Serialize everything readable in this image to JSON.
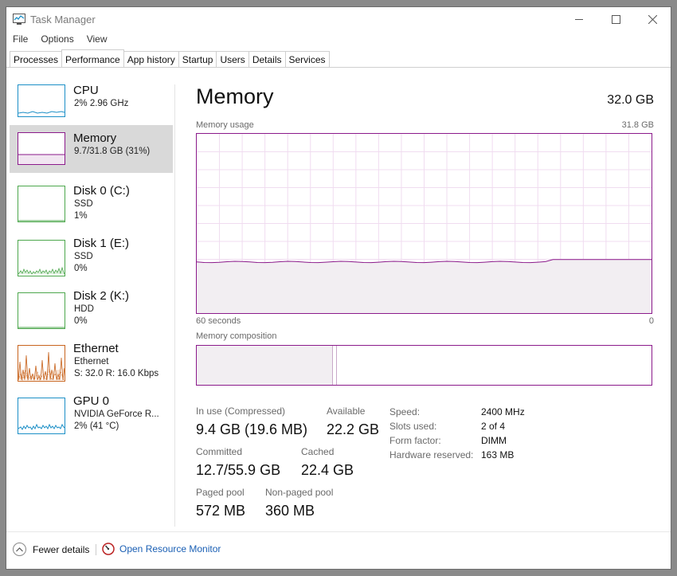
{
  "window": {
    "title": "Task Manager"
  },
  "menu": [
    "File",
    "Options",
    "View"
  ],
  "tabs": [
    "Processes",
    "Performance",
    "App history",
    "Startup",
    "Users",
    "Details",
    "Services"
  ],
  "active_tab": "Performance",
  "sidebar": {
    "items": [
      {
        "title": "CPU",
        "lines": [
          "2% 2.96 GHz"
        ],
        "color": "#1c8fc7"
      },
      {
        "title": "Memory",
        "lines": [
          "9.7/31.8 GB (31%)"
        ],
        "color": "#8b1a8b"
      },
      {
        "title": "Disk 0 (C:)",
        "lines": [
          "SSD",
          "1%"
        ],
        "color": "#4da74d"
      },
      {
        "title": "Disk 1 (E:)",
        "lines": [
          "SSD",
          "0%"
        ],
        "color": "#4da74d"
      },
      {
        "title": "Disk 2 (K:)",
        "lines": [
          "HDD",
          "0%"
        ],
        "color": "#4da74d"
      },
      {
        "title": "Ethernet",
        "lines": [
          "Ethernet",
          "S: 32.0  R: 16.0 Kbps"
        ],
        "color": "#c8641e"
      },
      {
        "title": "GPU 0",
        "lines": [
          "NVIDIA GeForce R...",
          "2% (41 °C)"
        ],
        "color": "#1c8fc7"
      }
    ]
  },
  "main": {
    "title": "Memory",
    "total": "32.0 GB",
    "usage_label": "Memory usage",
    "usage_max": "31.8 GB",
    "x_left": "60 seconds",
    "x_right": "0",
    "composition_label": "Memory composition",
    "accent": "#8b1a8b",
    "usage_fraction": 0.31,
    "composition_in_use_fraction": 0.3
  },
  "stats": {
    "in_use_label": "In use (Compressed)",
    "in_use_value": "9.4 GB (19.6 MB)",
    "available_label": "Available",
    "available_value": "22.2 GB",
    "committed_label": "Committed",
    "committed_value": "12.7/55.9 GB",
    "cached_label": "Cached",
    "cached_value": "22.4 GB",
    "paged_label": "Paged pool",
    "paged_value": "572 MB",
    "nonpaged_label": "Non-paged pool",
    "nonpaged_value": "360 MB"
  },
  "details": {
    "speed_label": "Speed:",
    "speed_value": "2400 MHz",
    "slots_label": "Slots used:",
    "slots_value": "2 of 4",
    "form_label": "Form factor:",
    "form_value": "DIMM",
    "reserved_label": "Hardware reserved:",
    "reserved_value": "163 MB"
  },
  "footer": {
    "fewer_details": "Fewer details",
    "open_resource_monitor": "Open Resource Monitor"
  }
}
